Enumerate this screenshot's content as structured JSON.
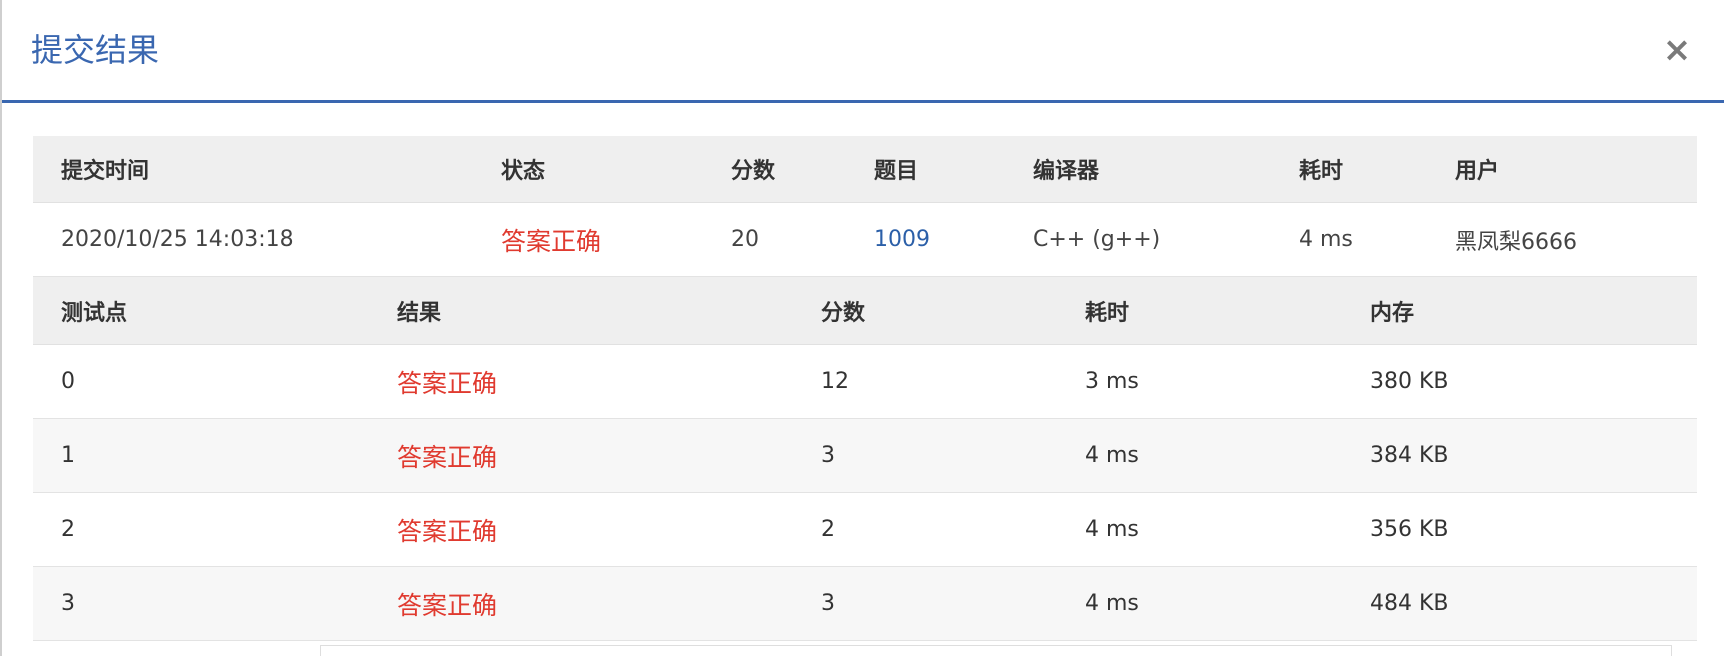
{
  "modal": {
    "title": "提交结果",
    "close_symbol": "×"
  },
  "submission": {
    "headers": {
      "time": "提交时间",
      "status": "状态",
      "score": "分数",
      "problem": "题目",
      "compiler": "编译器",
      "duration": "耗时",
      "user": "用户"
    },
    "row": {
      "time": "2020/10/25 14:03:18",
      "status": "答案正确",
      "score": "20",
      "problem": "1009",
      "compiler": "C++ (g++)",
      "duration": "4 ms",
      "user": "黑凤梨6666"
    }
  },
  "test_points": {
    "headers": {
      "point": "测试点",
      "result": "结果",
      "score": "分数",
      "duration": "耗时",
      "memory": "内存"
    },
    "rows": [
      {
        "point": "0",
        "result": "答案正确",
        "score": "12",
        "duration": "3 ms",
        "memory": "380 KB"
      },
      {
        "point": "1",
        "result": "答案正确",
        "score": "3",
        "duration": "4 ms",
        "memory": "384 KB"
      },
      {
        "point": "2",
        "result": "答案正确",
        "score": "2",
        "duration": "4 ms",
        "memory": "356 KB"
      },
      {
        "point": "3",
        "result": "答案正确",
        "score": "3",
        "duration": "4 ms",
        "memory": "484 KB"
      }
    ]
  },
  "colors": {
    "accent": "#3a67b0",
    "success_text": "#e03a2f",
    "link": "#2b5fa8",
    "header_bg": "#efefef"
  }
}
